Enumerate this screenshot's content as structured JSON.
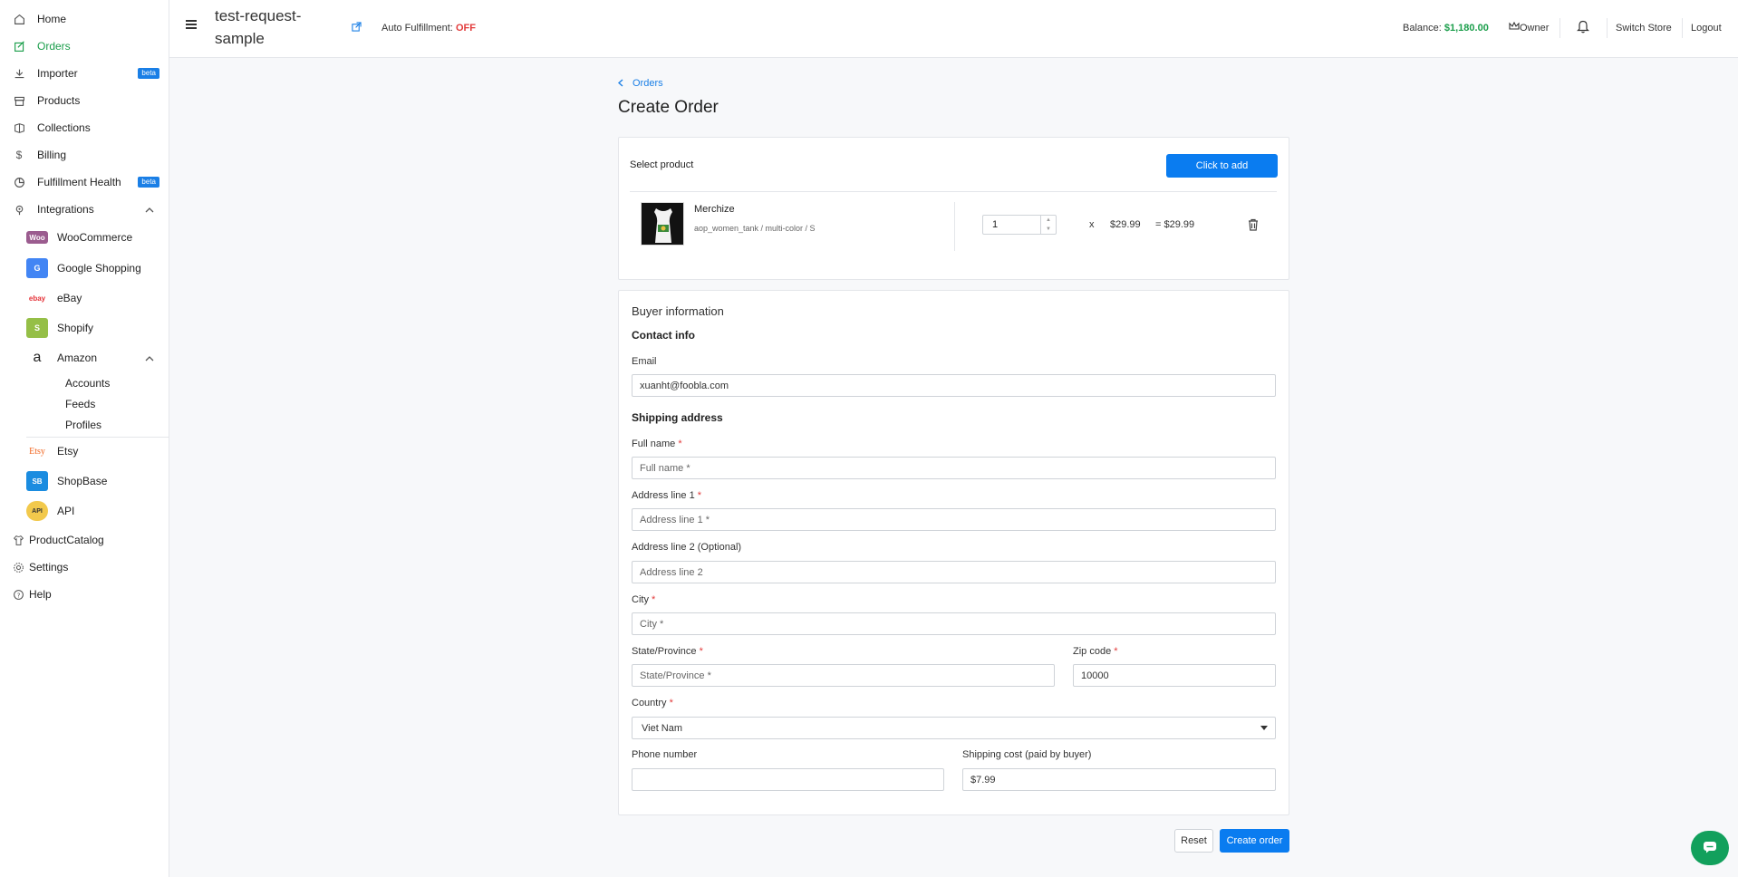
{
  "sidebar": {
    "items": [
      {
        "label": "Home",
        "icon": "home-icon"
      },
      {
        "label": "Orders",
        "icon": "orders-icon",
        "active": true
      },
      {
        "label": "Importer",
        "icon": "download-icon",
        "badge": "beta"
      },
      {
        "label": "Products",
        "icon": "box-icon"
      },
      {
        "label": "Collections",
        "icon": "collections-icon"
      },
      {
        "label": "Billing",
        "icon": "dollar-icon"
      },
      {
        "label": "Fulfillment Health",
        "icon": "pie-chart-icon",
        "badge": "beta"
      },
      {
        "label": "Integrations",
        "icon": "integrations-icon"
      }
    ],
    "integrations": [
      {
        "label": "WooCommerce",
        "logo": "Woo"
      },
      {
        "label": "Google Shopping",
        "logo": "G"
      },
      {
        "label": "eBay",
        "logo": "ebay"
      },
      {
        "label": "Shopify",
        "logo": "S"
      },
      {
        "label": "Amazon",
        "logo": "a"
      }
    ],
    "amazon_sub": [
      "Accounts",
      "Feeds",
      "Profiles"
    ],
    "integrations_more": [
      {
        "label": "Etsy",
        "logo": "Etsy"
      },
      {
        "label": "ShopBase",
        "logo": "SB"
      },
      {
        "label": "API",
        "logo": "API"
      }
    ],
    "bottom": [
      {
        "label": "ProductCatalog",
        "icon": "shirt-icon"
      },
      {
        "label": "Settings",
        "icon": "gear-icon"
      },
      {
        "label": "Help",
        "icon": "help-icon"
      }
    ]
  },
  "header": {
    "store_name": "test-request-sample",
    "auto_fulfillment_label": "Auto Fulfillment:",
    "auto_fulfillment_value": "OFF",
    "balance_label": "Balance:",
    "balance_value": "$1,180.00",
    "role": "Owner",
    "switch_store": "Switch Store",
    "logout": "Logout"
  },
  "page": {
    "breadcrumb": "Orders",
    "title": "Create Order"
  },
  "product_section": {
    "label": "Select product",
    "add_button": "Click to add",
    "item": {
      "name": "Merchize",
      "variant": "aop_women_tank / multi-color / S",
      "quantity": "1",
      "times": "x",
      "unit_price": "$29.99",
      "total": "= $29.99"
    }
  },
  "buyer": {
    "title": "Buyer information",
    "contact_title": "Contact info",
    "email_label": "Email",
    "email_value": "xuanht@foobla.com",
    "shipping_title": "Shipping address",
    "full_name_label": "Full name",
    "full_name_placeholder": "Full name *",
    "address1_label": "Address line 1",
    "address1_placeholder": "Address line 1 *",
    "address2_label": "Address line 2 (Optional)",
    "address2_placeholder": "Address line 2",
    "city_label": "City",
    "city_placeholder": "City *",
    "state_label": "State/Province",
    "state_placeholder": "State/Province *",
    "zip_label": "Zip code",
    "zip_value": "10000",
    "country_label": "Country",
    "country_value": "Viet Nam",
    "phone_label": "Phone number",
    "phone_value": "",
    "shipping_cost_label": "Shipping cost (paid by buyer)",
    "shipping_cost_value": "$7.99",
    "required_mark": "*"
  },
  "actions": {
    "reset": "Reset",
    "create": "Create order"
  },
  "colors": {
    "accent": "#0a7cf0",
    "active_nav": "#1b9e4b",
    "danger": "#e23b3b",
    "chat": "#12a05c"
  }
}
